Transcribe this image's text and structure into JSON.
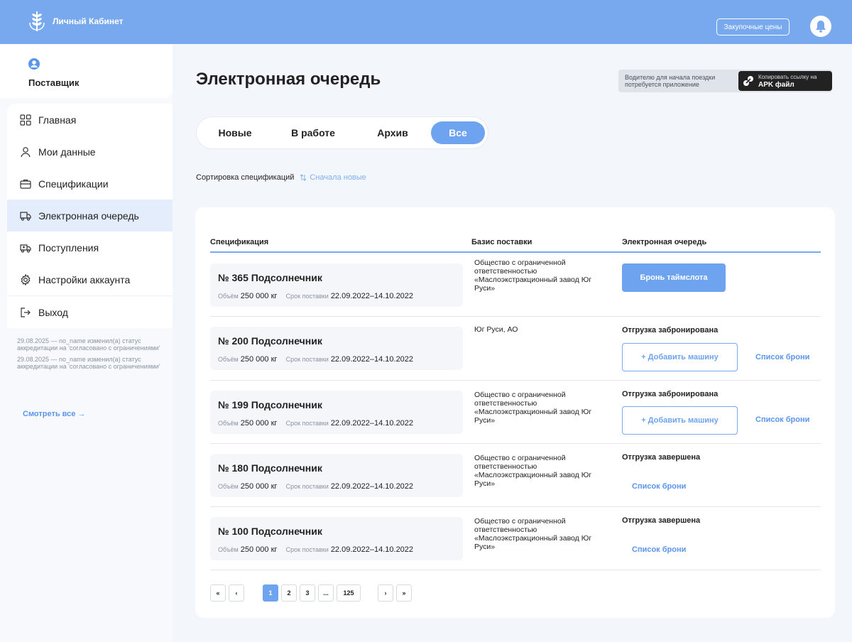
{
  "header": {
    "app_title": "Личный Кабинет",
    "price_button": "Закупочные цены",
    "icons": {
      "logo": "wheat-logo-icon",
      "bell": "bell-icon"
    }
  },
  "sidebar": {
    "role": "Поставщик",
    "menu": [
      {
        "label": "Главная",
        "icon": "grid-icon"
      },
      {
        "label": "Мои данные",
        "icon": "user-icon"
      },
      {
        "label": "Спецификации",
        "icon": "briefcase-icon"
      },
      {
        "label": "Электронная очередь",
        "icon": "truck-icon",
        "active": true
      },
      {
        "label": "Поступления",
        "icon": "delivery-icon"
      },
      {
        "label": "Настройки аккаунта",
        "icon": "gear-icon"
      },
      {
        "label": "Выход",
        "icon": "logout-icon"
      }
    ],
    "notifications": [
      "29.08.2025 — no_name изменил(а) статус аккредитации на 'согласовано с ограничениями'",
      "29.08.2025 — no_name изменил(а) статус аккредитации на 'согласовано с ограничениями'"
    ],
    "see_all": "Смотреть все →"
  },
  "main": {
    "title": "Электронная очередь",
    "apk": {
      "note": "Водителю для начала поездки потребуется приложение",
      "button_line1": "Копировать ссылку на",
      "button_line2": "APK файл"
    },
    "tabs": [
      "Новые",
      "В работе",
      "Архив",
      "Все"
    ],
    "active_tab": "Все",
    "sort": {
      "label": "Сортировка спецификаций",
      "value": "Сначала новые"
    },
    "table": {
      "headers": [
        "Спецификация",
        "Базис поставки",
        "Электронная очередь"
      ],
      "volume_label": "Объём",
      "term_label": "Срок поставки",
      "rows": [
        {
          "title": "№ 365 Подсолнечник",
          "volume": "250 000 кг",
          "term": "22.09.2022–14.10.2022",
          "basis": "Общество с ограниченной ответственностью «Маслоэкстракционный завод Юг Руси»",
          "action": "Бронь таймслота"
        },
        {
          "title": "№ 200 Подсолнечник",
          "volume": "250 000 кг",
          "term": "22.09.2022–14.10.2022",
          "basis": "Юг Руси, АО",
          "status": "Отгрузка забронирована",
          "add_button": "+ Добавить машину",
          "link": "Список брони"
        },
        {
          "title": "№ 199 Подсолнечник",
          "volume": "250 000 кг",
          "term": "22.09.2022–14.10.2022",
          "basis": "Общество с ограниченной ответственностью «Маслоэкстракционный завод Юг Руси»",
          "status": "Отгрузка забронирована",
          "add_button": "+ Добавить машину",
          "link": "Список брони"
        },
        {
          "title": "№ 180 Подсолнечник",
          "volume": "250 000 кг",
          "term": "22.09.2022–14.10.2022",
          "basis": "Общество с ограниченной ответственностью «Маслоэкстракционный завод Юг Руси»",
          "status": "Отгрузка завершена",
          "link": "Список брони"
        },
        {
          "title": "№ 100 Подсолнечник",
          "volume": "250 000 кг",
          "term": "22.09.2022–14.10.2022",
          "basis": "Общество с ограниченной ответственностью «Маслоэкстракционный завод Юг Руси»",
          "status": "Отгрузка завершена",
          "link": "Список брони"
        }
      ]
    },
    "pagination": {
      "first": "«",
      "prev": "‹",
      "pages": [
        "1",
        "2",
        "3",
        "...",
        "125"
      ],
      "current": "1",
      "next": "›",
      "last": "»"
    }
  },
  "colors": {
    "accent": "#6ea3ef",
    "header": "#78a8ee",
    "link": "#5b95ec",
    "active_menu": "#e4edfb"
  }
}
